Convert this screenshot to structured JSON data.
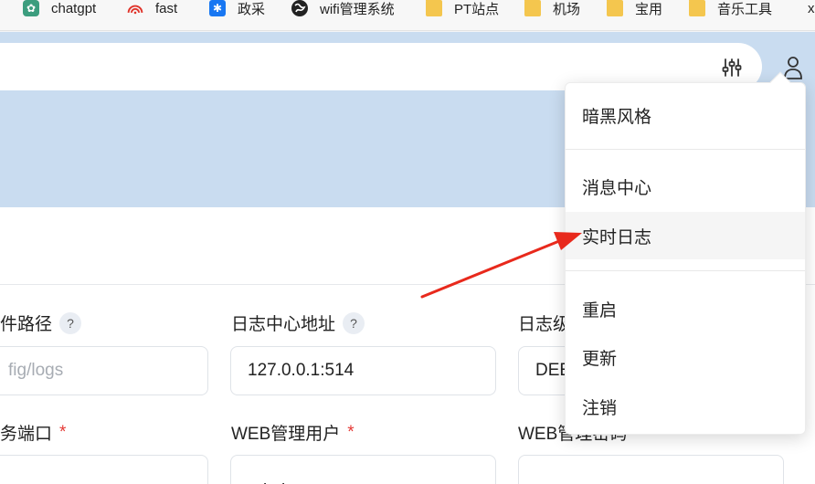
{
  "bookmarks": [
    {
      "label": "chatgpt",
      "icon": "chatgpt-icon"
    },
    {
      "label": "fast",
      "icon": "wifi-signal-icon"
    },
    {
      "label": "政采",
      "icon": "snowflake-icon"
    },
    {
      "label": "wifi管理系统",
      "icon": "globe-icon"
    },
    {
      "label": "PT站点",
      "icon": "folder-icon"
    },
    {
      "label": "机场",
      "icon": "folder-icon"
    },
    {
      "label": "宝用",
      "icon": "folder-icon"
    },
    {
      "label": "音乐工具",
      "icon": "folder-icon"
    },
    {
      "label": "x",
      "icon": ""
    }
  ],
  "header": {
    "filter_icon": "sliders-icon",
    "user_icon": "user-icon"
  },
  "form": {
    "row1": [
      {
        "label": "件路径",
        "help": "?",
        "value": "fig/logs",
        "is_placeholder": true
      },
      {
        "label": "日志中心地址",
        "help": "?",
        "value": "127.0.0.1:514",
        "is_placeholder": false
      },
      {
        "label": "日志级",
        "help": "",
        "value": "DEE",
        "is_placeholder": false
      }
    ],
    "row2": [
      {
        "label": "务端口",
        "required": "*",
        "value": ""
      },
      {
        "label": "WEB管理用户",
        "required": "*",
        "value": "admin"
      },
      {
        "label": "WEB管理密码",
        "required": "",
        "value": "••••••••••••••••••••"
      }
    ]
  },
  "menu": {
    "items": [
      {
        "label": "暗黑风格"
      },
      {
        "label": "消息中心"
      },
      {
        "label": "实时日志"
      },
      {
        "label": "重启"
      },
      {
        "label": "更新"
      },
      {
        "label": "注销"
      }
    ]
  },
  "colors": {
    "header_bg": "#c9dcf0",
    "arrow": "#e8291c",
    "required": "#e53935"
  }
}
